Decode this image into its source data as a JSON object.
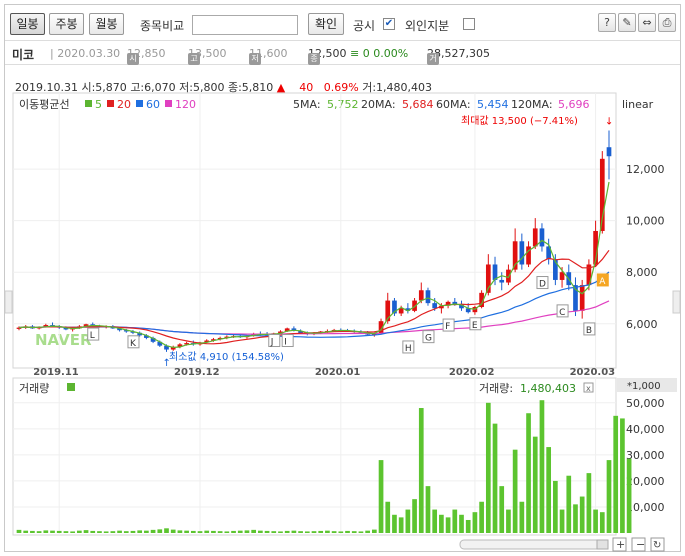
{
  "toolbar": {
    "period_day": "일봉",
    "period_week": "주봉",
    "period_month": "월봉",
    "compare_label": "종목비교",
    "compare_input_value": "",
    "confirm_button": "확인",
    "disclosure_label": "공시",
    "disclosure_checked": "✔",
    "foreign_label": "외인지분"
  },
  "info": {
    "name": "미코",
    "date": "2020.03.30",
    "open_tag": "시",
    "open": "12,850",
    "high_tag": "고",
    "high": "13,500",
    "low_tag": "저",
    "low": "11,600",
    "close_tag": "종",
    "close": "12,500",
    "change": "≡ 0",
    "change_pct": "0.00%",
    "volume_tag": "거",
    "volume": "28,527,305"
  },
  "ohlc": {
    "date": "2019.10.31",
    "open": "시:5,870",
    "high": "고:6,070",
    "low": "저:5,800",
    "close": "종:5,810",
    "change_icon": "▲",
    "change": "40",
    "change_pct": "0.69%",
    "volume": "거:1,480,403"
  },
  "ma": {
    "label": "이동평균선",
    "p5": "5",
    "p20": "20",
    "p60": "60",
    "p120": "120",
    "v5_label": "5MA:",
    "v5": "5,752",
    "v20_label": "20MA:",
    "v20": "5,684",
    "v60_label": "60MA:",
    "v60": "5,454",
    "v120_label": "120MA:",
    "v120": "5,696",
    "colors": {
      "ma5": "#5cb531",
      "ma20": "#e02020",
      "ma60": "#1f6fe0",
      "ma120": "#e040c0"
    }
  },
  "scale_label": "linear",
  "max_annotation": "최대값 13,500 (−7.41%)",
  "min_annotation": "최소값 4,910 (154.58%)",
  "watermark": "NAVER",
  "volume_panel": {
    "label": "거래량",
    "value_label": "거래량:",
    "value": "1,480,403",
    "unit_label": "*1,000",
    "close_icon": "x"
  },
  "event_markers": [
    "L",
    "K",
    "J",
    "I",
    "H",
    "G",
    "F",
    "E",
    "D",
    "C",
    "B",
    "A"
  ],
  "chart_data": [
    {
      "type": "candlestick",
      "xlabels": [
        "2019.11",
        "2019.12",
        "2020.01",
        "2020.02",
        "2020.03"
      ],
      "yticks": [
        6000,
        8000,
        10000,
        12000
      ],
      "ytick_labels": [
        "6,000",
        "8,000",
        "10,000",
        "12,000"
      ],
      "ylim": [
        4400,
        14100
      ],
      "max_value": 13500,
      "min_value": 4910,
      "candles": [
        [
          5800,
          5900,
          5750,
          5850
        ],
        [
          5850,
          5950,
          5800,
          5900
        ],
        [
          5900,
          5950,
          5800,
          5820
        ],
        [
          5820,
          5900,
          5780,
          5880
        ],
        [
          5880,
          6000,
          5850,
          5950
        ],
        [
          5950,
          6050,
          5900,
          5900
        ],
        [
          5900,
          5950,
          5800,
          5850
        ],
        [
          5850,
          5900,
          5750,
          5780
        ],
        [
          5780,
          5850,
          5700,
          5820
        ],
        [
          5820,
          5950,
          5800,
          5900
        ],
        [
          5900,
          6000,
          5850,
          5980
        ],
        [
          5980,
          6050,
          5900,
          5920
        ],
        [
          5920,
          5960,
          5850,
          5880
        ],
        [
          5880,
          5940,
          5820,
          5900
        ],
        [
          5900,
          5950,
          5800,
          5820
        ],
        [
          5820,
          5880,
          5700,
          5750
        ],
        [
          5750,
          5800,
          5650,
          5700
        ],
        [
          5700,
          5760,
          5600,
          5650
        ],
        [
          5650,
          5700,
          5500,
          5550
        ],
        [
          5550,
          5600,
          5400,
          5450
        ],
        [
          5450,
          5500,
          5250,
          5300
        ],
        [
          5300,
          5350,
          5100,
          5150
        ],
        [
          5150,
          5200,
          4910,
          5000
        ],
        [
          5000,
          5150,
          4950,
          5100
        ],
        [
          5100,
          5250,
          5050,
          5200
        ],
        [
          5200,
          5300,
          5150,
          5250
        ],
        [
          5250,
          5350,
          5150,
          5200
        ],
        [
          5200,
          5300,
          5150,
          5280
        ],
        [
          5280,
          5400,
          5250,
          5350
        ],
        [
          5350,
          5450,
          5300,
          5400
        ],
        [
          5400,
          5500,
          5350,
          5450
        ],
        [
          5450,
          5550,
          5400,
          5500
        ],
        [
          5500,
          5560,
          5450,
          5520
        ],
        [
          5520,
          5580,
          5450,
          5480
        ],
        [
          5480,
          5550,
          5420,
          5530
        ],
        [
          5530,
          5650,
          5500,
          5620
        ],
        [
          5620,
          5700,
          5550,
          5600
        ],
        [
          5600,
          5680,
          5520,
          5550
        ],
        [
          5550,
          5650,
          5520,
          5630
        ],
        [
          5630,
          5750,
          5600,
          5700
        ],
        [
          5700,
          5850,
          5680,
          5820
        ],
        [
          5820,
          5900,
          5700,
          5720
        ],
        [
          5720,
          5780,
          5600,
          5640
        ],
        [
          5640,
          5700,
          5550,
          5600
        ],
        [
          5600,
          5680,
          5560,
          5650
        ],
        [
          5650,
          5720,
          5600,
          5700
        ],
        [
          5700,
          5780,
          5650,
          5720
        ],
        [
          5720,
          5800,
          5680,
          5760
        ],
        [
          5760,
          5820,
          5700,
          5740
        ],
        [
          5740,
          5800,
          5680,
          5720
        ],
        [
          5720,
          5780,
          5650,
          5690
        ],
        [
          5690,
          5750,
          5620,
          5660
        ],
        [
          5660,
          5720,
          5550,
          5580
        ],
        [
          5580,
          5650,
          5500,
          5620
        ],
        [
          5620,
          6200,
          5600,
          6100
        ],
        [
          6100,
          7200,
          6000,
          6900
        ],
        [
          6900,
          7000,
          6300,
          6400
        ],
        [
          6400,
          6700,
          6300,
          6600
        ],
        [
          6600,
          6800,
          6400,
          6500
        ],
        [
          6500,
          7000,
          6450,
          6900
        ],
        [
          6900,
          7600,
          6800,
          7300
        ],
        [
          7300,
          7400,
          6700,
          6800
        ],
        [
          6800,
          7000,
          6500,
          6600
        ],
        [
          6600,
          6800,
          6400,
          6700
        ],
        [
          6700,
          6900,
          6600,
          6850
        ],
        [
          6850,
          7000,
          6700,
          6750
        ],
        [
          6750,
          6900,
          6500,
          6600
        ],
        [
          6600,
          6800,
          6400,
          6450
        ],
        [
          6450,
          6700,
          6350,
          6650
        ],
        [
          6650,
          7300,
          6600,
          7200
        ],
        [
          7200,
          8700,
          7100,
          8300
        ],
        [
          8300,
          8600,
          7500,
          7700
        ],
        [
          7700,
          8000,
          7300,
          7600
        ],
        [
          7600,
          8300,
          7500,
          8100
        ],
        [
          8100,
          9700,
          8000,
          9200
        ],
        [
          9200,
          9500,
          8100,
          8300
        ],
        [
          8300,
          9200,
          8200,
          9000
        ],
        [
          9000,
          10100,
          8900,
          9700
        ],
        [
          9700,
          9900,
          8800,
          9000
        ],
        [
          9000,
          9300,
          8300,
          8500
        ],
        [
          8500,
          8700,
          7500,
          7700
        ],
        [
          7700,
          8200,
          7400,
          8000
        ],
        [
          8000,
          8300,
          7300,
          7500
        ],
        [
          7500,
          7800,
          6300,
          6500
        ],
        [
          6500,
          7700,
          6200,
          7500
        ],
        [
          7500,
          8500,
          7300,
          8300
        ],
        [
          8300,
          10000,
          8200,
          9600
        ],
        [
          9600,
          12700,
          9500,
          12400
        ],
        [
          12850,
          13500,
          11600,
          12500
        ]
      ],
      "ma_endpoints": {
        "ma5": 9900,
        "ma20": 8000,
        "ma60": 6800,
        "ma120": 6200
      }
    },
    {
      "type": "bar",
      "title": "거래량",
      "yticks": [
        10000,
        20000,
        30000,
        40000,
        50000
      ],
      "ytick_labels": [
        "10,000",
        "20,000",
        "30,000",
        "40,000",
        "50,000"
      ],
      "ylim": [
        0,
        53000
      ],
      "values": [
        1200,
        900,
        800,
        700,
        1000,
        900,
        800,
        700,
        600,
        900,
        1100,
        800,
        700,
        600,
        700,
        900,
        700,
        800,
        1000,
        900,
        1200,
        1400,
        1800,
        1300,
        1000,
        900,
        800,
        700,
        900,
        800,
        700,
        600,
        800,
        900,
        1000,
        1200,
        900,
        800,
        700,
        600,
        800,
        900,
        700,
        600,
        700,
        800,
        900,
        700,
        600,
        800,
        700,
        600,
        900,
        1300,
        28000,
        12000,
        7000,
        6000,
        9000,
        13000,
        48000,
        18000,
        9000,
        7000,
        6000,
        9000,
        7000,
        5000,
        8000,
        12000,
        50000,
        42000,
        18000,
        9000,
        32000,
        12000,
        46000,
        37000,
        51000,
        33000,
        20000,
        9000,
        22000,
        11000,
        14000,
        23000,
        9000,
        8000,
        28000,
        45000,
        44000,
        28527
      ]
    }
  ]
}
